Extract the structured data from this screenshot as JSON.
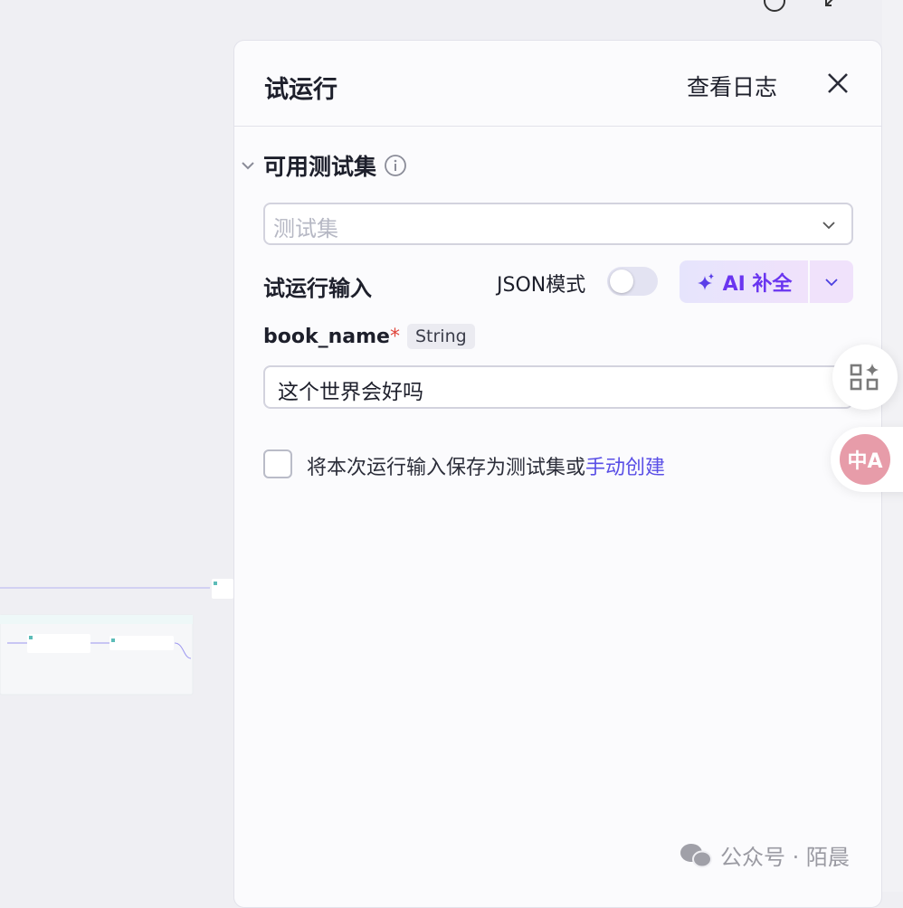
{
  "panel": {
    "title": "试运行",
    "view_log": "查看日志"
  },
  "testset": {
    "section_label": "可用测试集",
    "placeholder": "测试集"
  },
  "run_input": {
    "label": "试运行输入",
    "json_mode_label": "JSON模式",
    "json_mode_on": false,
    "ai_label": "AI 补全"
  },
  "field": {
    "name": "book_name",
    "required_mark": "*",
    "type": "String",
    "value": "这个世界会好吗"
  },
  "save": {
    "text": "将本次运行输入保存为测试集或",
    "link": "手动创建",
    "checked": false
  },
  "floating": {
    "translate_label": "中A"
  },
  "watermark": {
    "text": "公众号 · 陌晨"
  },
  "colors": {
    "accent": "#6a35f0",
    "link": "#5a4fe6",
    "translate": "#e79ca9"
  }
}
